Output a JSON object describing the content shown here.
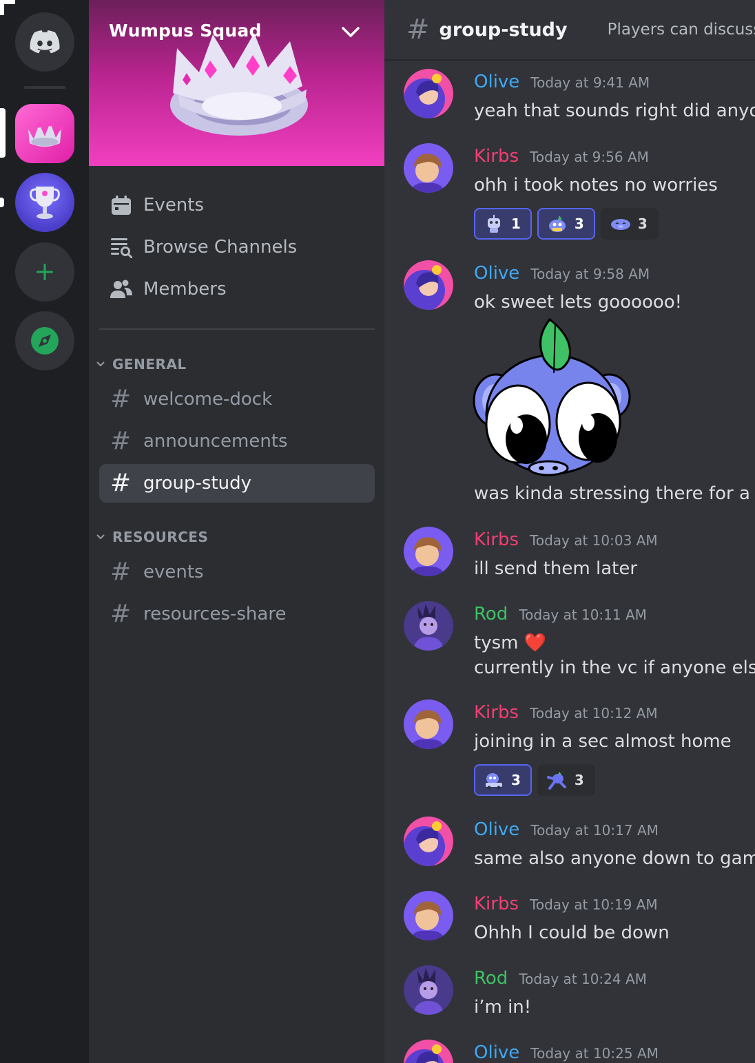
{
  "rail": {
    "servers": [
      {
        "name": "home",
        "icon": "discord-logo-icon"
      },
      {
        "name": "wumpus-squad",
        "icon": "crown-icon",
        "active": true
      },
      {
        "name": "trophy-server",
        "icon": "trophy-icon",
        "unread": true
      },
      {
        "name": "add-server",
        "icon": "plus-icon"
      },
      {
        "name": "discover",
        "icon": "compass-icon"
      }
    ],
    "colors": {
      "bg": "#1e1f22",
      "accent_green": "#23a55a"
    }
  },
  "sidebar": {
    "server_name": "Wumpus Squad",
    "nav": [
      {
        "label": "Events",
        "icon": "calendar-icon"
      },
      {
        "label": "Browse Channels",
        "icon": "browse-channels-icon"
      },
      {
        "label": "Members",
        "icon": "members-icon"
      }
    ],
    "categories": [
      {
        "label": "GENERAL",
        "channels": [
          "welcome-dock",
          "announcements",
          "group-study"
        ]
      },
      {
        "label": "RESOURCES",
        "channels": [
          "events",
          "resources-share"
        ]
      }
    ],
    "active_channel": "group-study"
  },
  "header": {
    "channel": "group-study",
    "topic": "Players can discuss str"
  },
  "messages": [
    {
      "user": "Olive",
      "time": "Today at 9:41 AM",
      "lines": [
        "yeah that sounds right did anyone"
      ]
    },
    {
      "user": "Kirbs",
      "time": "Today at 9:56 AM",
      "lines": [
        "ohh i took notes no worries"
      ],
      "reactions": [
        {
          "emoji": "robot-emoji",
          "count": "1",
          "on": true
        },
        {
          "emoji": "wumpus-book-emoji",
          "count": "3",
          "on": true
        },
        {
          "emoji": "wumpus-sleep-emoji",
          "count": "3",
          "on": false
        }
      ]
    },
    {
      "user": "Olive",
      "time": "Today at 9:58 AM",
      "lines": [
        "ok sweet lets goooooo!",
        "was kinda stressing there for a bit"
      ],
      "sticker": "blueberry-wumpus-sticker"
    },
    {
      "user": "Kirbs",
      "time": "Today at 10:03 AM",
      "lines": [
        "ill send them later"
      ]
    },
    {
      "user": "Rod",
      "time": "Today at 10:11 AM",
      "lines": [
        "tysm ❤️",
        "currently in the vc if anyone else w"
      ]
    },
    {
      "user": "Kirbs",
      "time": "Today at 10:12 AM",
      "lines": [
        "joining in a sec almost home"
      ],
      "reactions": [
        {
          "emoji": "wumpus-car-emoji",
          "count": "3",
          "on": true
        },
        {
          "emoji": "wumpus-run-emoji",
          "count": "3",
          "on": false
        }
      ]
    },
    {
      "user": "Olive",
      "time": "Today at 10:17 AM",
      "lines": [
        "same also anyone down to game la"
      ]
    },
    {
      "user": "Kirbs",
      "time": "Today at 10:19 AM",
      "lines": [
        "Ohhh I could be down"
      ]
    },
    {
      "user": "Rod",
      "time": "Today at 10:24 AM",
      "lines": [
        "i’m in!"
      ]
    },
    {
      "user": "Olive",
      "time": "Today at 10:25 AM",
      "lines": []
    }
  ],
  "user_colors": {
    "Olive": "#3fa9f5",
    "Kirbs": "#f23f72",
    "Rod": "#3ec265"
  }
}
